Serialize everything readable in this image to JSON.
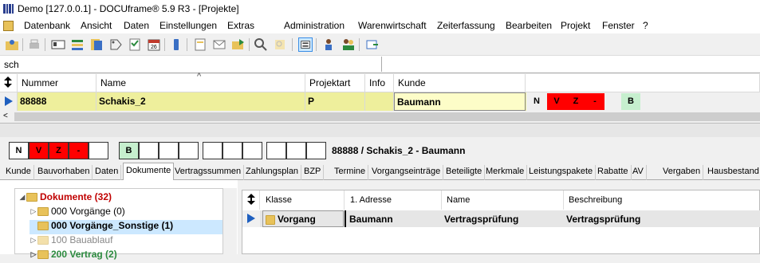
{
  "window": {
    "title": "Demo [127.0.0.1] - DOCUframe® 5.9 R3 - [Projekte]"
  },
  "menu": [
    "Datenbank",
    "Ansicht",
    "Daten",
    "Einstellungen",
    "Extras",
    "Administration",
    "Warenwirtschaft",
    "Zeiterfassung",
    "Bearbeiten",
    "Projekt",
    "Fenster",
    "?"
  ],
  "search": {
    "value": "sch"
  },
  "grid": {
    "columns": [
      "Nummer",
      "Name",
      "Projektart",
      "Info",
      "Kunde"
    ],
    "row": {
      "nummer": "88888",
      "name": "Schakis_2",
      "projektart": "P",
      "info": "",
      "kunde": "Baumann"
    },
    "flags": [
      "N",
      "V",
      "Z",
      "-",
      "B"
    ]
  },
  "status_boxes": [
    "N",
    "V",
    "Z",
    "-",
    "B"
  ],
  "status_text": "88888 / Schakis_2 - Baumann",
  "tabs": [
    "Kunde",
    "Bauvorhaben",
    "Daten",
    "Dokumente",
    "Vertragssummen",
    "Zahlungsplan",
    "BZP",
    "Termine",
    "Vorgangseinträge",
    "Beteiligte",
    "Merkmale",
    "Leistungspakete",
    "Rabatte",
    "AV",
    "Vergaben",
    "Hausbestand"
  ],
  "active_tab": "Dokumente",
  "tree": [
    {
      "label": "Dokumente (32)",
      "level": 0
    },
    {
      "label": "000 Vorgänge (0)",
      "level": 1
    },
    {
      "label": "000 Vorgänge_Sonstige (1)",
      "level": 1
    },
    {
      "label": "100 Bauablauf",
      "level": 1
    },
    {
      "label": "200 Vertrag (2)",
      "level": 1
    }
  ],
  "docs": {
    "columns": [
      "Klasse",
      "1. Adresse",
      "Name",
      "Beschreibung"
    ],
    "row": {
      "klasse": "Vorgang",
      "adresse": "Baumann",
      "name": "Vertragsprüfung",
      "beschreibung": "Vertragsprüfung"
    }
  },
  "colors": {
    "highlight_row": "#eeef9c",
    "flag_red": "#ff0000",
    "flag_green": "#c6efce",
    "selection": "#cce8ff",
    "tree_root": "#c00000"
  }
}
